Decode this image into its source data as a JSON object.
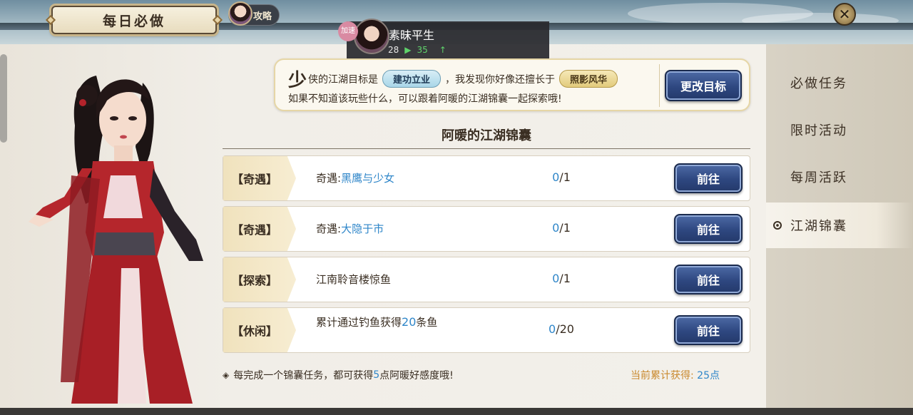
{
  "header": {
    "title": "每日必做",
    "guide_label": "攻略",
    "close_icon": "close-icon"
  },
  "player": {
    "name": "素昧平生",
    "badge": "加速",
    "level": "28",
    "score": "35"
  },
  "goal_box": {
    "big_char": "少",
    "text_part1": "侠的江湖目标是",
    "goal_tag": "建功立业",
    "text_part2": "，我发现你好像还擅长于",
    "skill_tag": "照影风华",
    "line2": "如果不知道该玩些什么，可以跟着阿暖的江湖锦囊一起探索哦!",
    "change_button": "更改目标"
  },
  "section": {
    "title": "阿暖的江湖锦囊"
  },
  "tasks": [
    {
      "tag": "【奇遇】",
      "prefix": "奇遇:",
      "link": "黑鹰与少女",
      "current": "0",
      "total": "/1",
      "button": "前往"
    },
    {
      "tag": "【奇遇】",
      "prefix": "奇遇:",
      "link": "大隐于市",
      "current": "0",
      "total": "/1",
      "button": "前往"
    },
    {
      "tag": "【探索】",
      "name": "江南聆音楼惊鱼",
      "current": "0",
      "total": "/1",
      "button": "前往"
    },
    {
      "tag": "【休闲】",
      "name_a": "累计通过钓鱼获得",
      "name_num": "20",
      "name_b": "条鱼",
      "current": "0",
      "total": "/20",
      "button": "前往"
    }
  ],
  "footer": {
    "note_a": "每完成一个锦囊任务，都可获得",
    "note_num": "5",
    "note_b": "点阿暖好感度哦!",
    "total_label": "当前累计获得: ",
    "total_num": "25",
    "total_unit": "点"
  },
  "side_nav": [
    {
      "label": "必做任务",
      "active": false
    },
    {
      "label": "限时活动",
      "active": false
    },
    {
      "label": "每周活跃",
      "active": false
    },
    {
      "label": "江湖锦囊",
      "active": true
    }
  ],
  "colors": {
    "accent_blue": "#2f86c9",
    "button_blue": "#2e4780",
    "gold_text": "#c9892e",
    "panel_bg": "#f3f0ea"
  }
}
